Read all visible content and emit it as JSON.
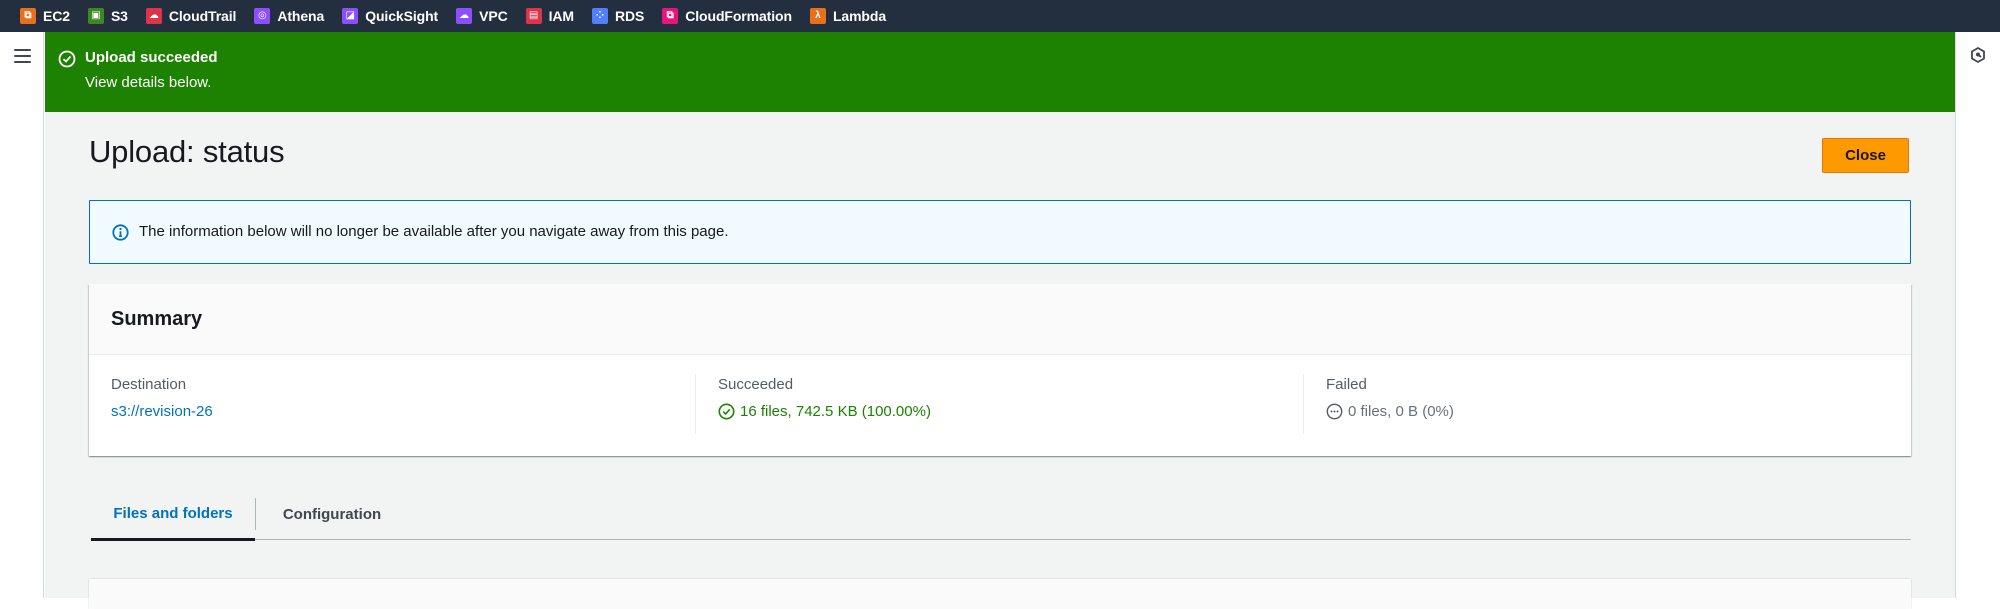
{
  "topbar": {
    "services": [
      {
        "label": "EC2",
        "icon": "ec2-icon",
        "color": "#e7711b",
        "glyph": "⧉"
      },
      {
        "label": "S3",
        "icon": "s3-icon",
        "color": "#3f8624",
        "glyph": "▣"
      },
      {
        "label": "CloudTrail",
        "icon": "cloudtrail-icon",
        "color": "#dd344c",
        "glyph": "☁"
      },
      {
        "label": "Athena",
        "icon": "athena-icon",
        "color": "#8c4fff",
        "glyph": "◎"
      },
      {
        "label": "QuickSight",
        "icon": "quicksight-icon",
        "color": "#8c4fff",
        "glyph": "◪"
      },
      {
        "label": "VPC",
        "icon": "vpc-icon",
        "color": "#8c4fff",
        "glyph": "☁"
      },
      {
        "label": "IAM",
        "icon": "iam-icon",
        "color": "#dd344c",
        "glyph": "▤"
      },
      {
        "label": "RDS",
        "icon": "rds-icon",
        "color": "#527fff",
        "glyph": "⁘"
      },
      {
        "label": "CloudFormation",
        "icon": "cloudformation-icon",
        "color": "#e7157b",
        "glyph": "⧉"
      },
      {
        "label": "Lambda",
        "icon": "lambda-icon",
        "color": "#e7711b",
        "glyph": "λ"
      }
    ]
  },
  "flash": {
    "title": "Upload succeeded",
    "message": "View details below.",
    "color": "#1d8102"
  },
  "page": {
    "title": "Upload: status",
    "close_label": "Close"
  },
  "info_alert": {
    "text": "The information below will no longer be available after you navigate away from this page."
  },
  "summary": {
    "title": "Summary",
    "destination": {
      "label": "Destination",
      "value": "s3://revision-26"
    },
    "succeeded": {
      "label": "Succeeded",
      "value": "16 files, 742.5 KB (100.00%)"
    },
    "failed": {
      "label": "Failed",
      "value": "0 files, 0 B (0%)"
    }
  },
  "tabs": [
    {
      "label": "Files and folders",
      "active": true
    },
    {
      "label": "Configuration",
      "active": false
    }
  ]
}
